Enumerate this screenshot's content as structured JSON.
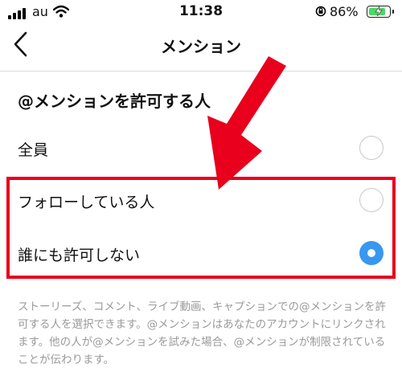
{
  "status_bar": {
    "carrier": "au",
    "time": "11:38",
    "battery_percent": "86%",
    "battery_level": 0.86,
    "icons": [
      "signal-icon",
      "wifi-icon",
      "rotation-lock-icon",
      "battery-charging-icon"
    ]
  },
  "header": {
    "title": "メンション",
    "back_icon": "chevron-left-icon"
  },
  "section": {
    "title": "@メンションを許可する人"
  },
  "options": [
    {
      "label": "全員",
      "selected": false
    },
    {
      "label": "フォローしている人",
      "selected": false
    },
    {
      "label": "誰にも許可しない",
      "selected": true
    }
  ],
  "description": "ストーリーズ、コメント、ライブ動画、キャプションでの@メンションを許可する人を選択できます。@メンションはあなたのアカウントにリンクされます。他の人が@メンションを試みた場合、@メンションが制限されていることが伝わります。",
  "annotation": {
    "color": "#e8001c",
    "shapes": [
      "red-arrow",
      "red-highlight-box"
    ]
  },
  "colors": {
    "selected_radio": "#3897f0",
    "description_text": "#9a9a9a"
  }
}
